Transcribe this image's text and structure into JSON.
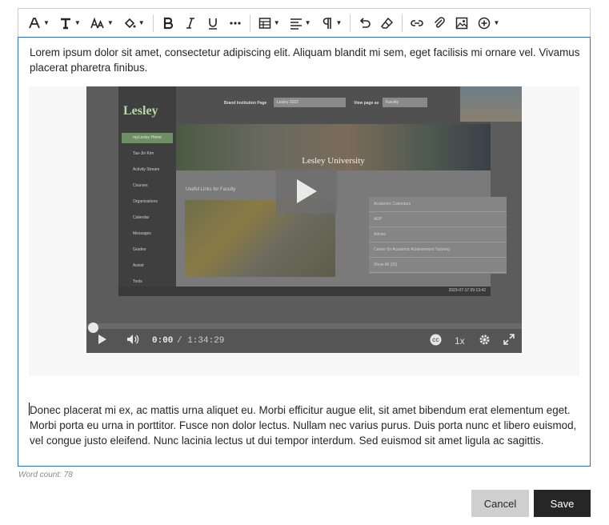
{
  "toolbar": {
    "buttons": [
      {
        "name": "font-style-icon",
        "dropdown": true
      },
      {
        "name": "text-format-icon",
        "dropdown": true
      },
      {
        "name": "font-size-icon",
        "dropdown": true
      },
      {
        "name": "text-color-icon",
        "dropdown": true
      },
      {
        "name": "bold-icon",
        "dropdown": false
      },
      {
        "name": "italic-icon",
        "dropdown": false
      },
      {
        "name": "underline-icon",
        "dropdown": false
      },
      {
        "name": "more-formats-icon",
        "dropdown": false
      },
      {
        "name": "table-icon",
        "dropdown": true
      },
      {
        "name": "align-icon",
        "dropdown": true
      },
      {
        "name": "paragraph-icon",
        "dropdown": true
      },
      {
        "name": "undo-icon",
        "dropdown": false
      },
      {
        "name": "clear-formatting-icon",
        "dropdown": false
      },
      {
        "name": "link-icon",
        "dropdown": false
      },
      {
        "name": "attach-icon",
        "dropdown": false
      },
      {
        "name": "image-icon",
        "dropdown": false
      },
      {
        "name": "insert-content-icon",
        "dropdown": true
      }
    ]
  },
  "editor": {
    "paragraph1": "Lorem ipsum dolor sit amet, consectetur adipiscing elit. Aliquam blandit mi sem, eget facilisis mi ornare vel. Vivamus placerat pharetra finibus.",
    "paragraph2": "Donec placerat mi ex, ac mattis urna aliquet eu. Morbi efficitur augue elit, sit amet bibendum erat elementum eget. Morbi porta eu urna in porttitor. Fusce non dolor lectus. Nullam nec varius purus. Duis porta nunc et libero euismod, vel congue justo eleifend. Nunc lacinia lectus ut dui tempor interdum. Sed euismod sit amet ligula ac sagittis."
  },
  "video": {
    "current_time": "0:00",
    "duration": "/ 1:34:29",
    "speed": "1x",
    "progress": 0,
    "screenshot": {
      "logo": "Lesley",
      "banner_title": "Lesley University",
      "nav_items": [
        "myLesley Home",
        "Tae-Jin Kim",
        "Activity Stream",
        "Courses",
        "Organizations",
        "Calendar",
        "Messages",
        "Grades",
        "Assist",
        "Tools"
      ],
      "links_heading": "Useful Links for Faculty",
      "links": [
        "Academic Calendars",
        "ADP",
        "Advise",
        "Center for Academic Achievement Tutoring",
        "Show All (20)"
      ],
      "brand_label": "Brand Institution Page",
      "brand_value": "Lesley 2022",
      "view_label": "View page as",
      "view_value": "Faculty",
      "clock": "2023-07-17 09:13:42"
    }
  },
  "word_count": "Word count: 78",
  "actions": {
    "cancel": "Cancel",
    "save": "Save"
  },
  "colors": {
    "editor_border": "#2a6fd6",
    "save_bg": "#262626",
    "cancel_bg": "#cfcfcf"
  }
}
